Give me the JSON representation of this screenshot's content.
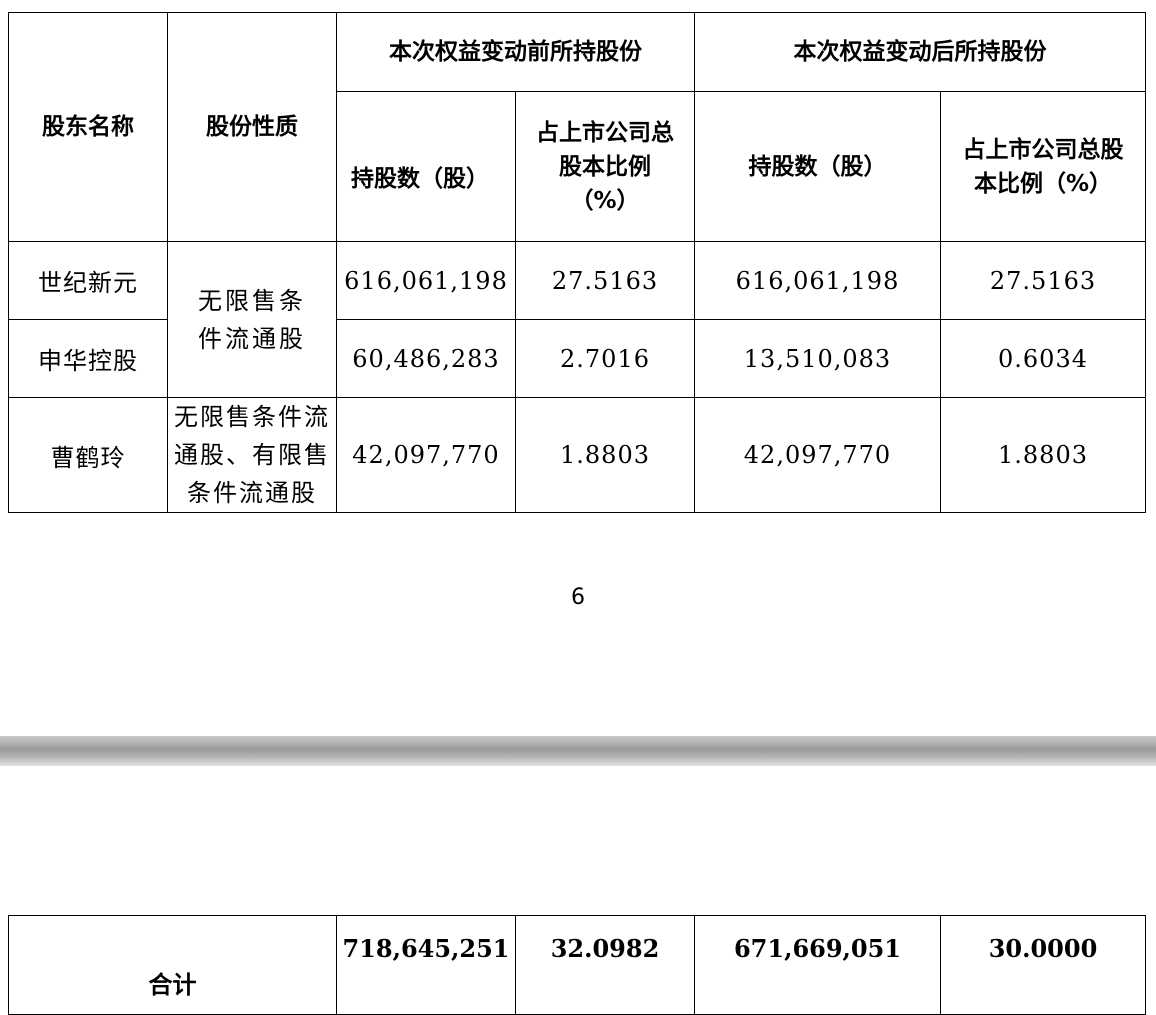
{
  "table": {
    "header": {
      "shareholder_name": "股东名称",
      "share_nature": "股份性质",
      "before_group": "本次权益变动前所持股份",
      "after_group": "本次权益变动后所持股份",
      "before_shares": "持股数（股）",
      "before_ratio": "占上市公司总股本比例（%）",
      "after_shares": "持股数（股）",
      "after_ratio": "占上市公司总股本比例（%）"
    },
    "rows": [
      {
        "name": "世纪新元",
        "before_shares": "616,061,198",
        "before_ratio": "27.5163",
        "after_shares": "616,061,198",
        "after_ratio": "27.5163"
      },
      {
        "name": "申华控股",
        "before_shares": "60,486,283",
        "before_ratio": "2.7016",
        "after_shares": "13,510,083",
        "after_ratio": "0.6034"
      },
      {
        "name": "曹鹤玲",
        "before_shares": "42,097,770",
        "before_ratio": "1.8803",
        "after_shares": "42,097,770",
        "after_ratio": "1.8803"
      }
    ],
    "nature_merged": "无限售条件流通股",
    "nature_row3": "无限售条件流通股、有限售条件流通股"
  },
  "page_number": "6",
  "total": {
    "label": "合计",
    "before_shares": "718,645,251",
    "before_ratio": "32.0982",
    "after_shares": "671,669,051",
    "after_ratio": "30.0000"
  }
}
